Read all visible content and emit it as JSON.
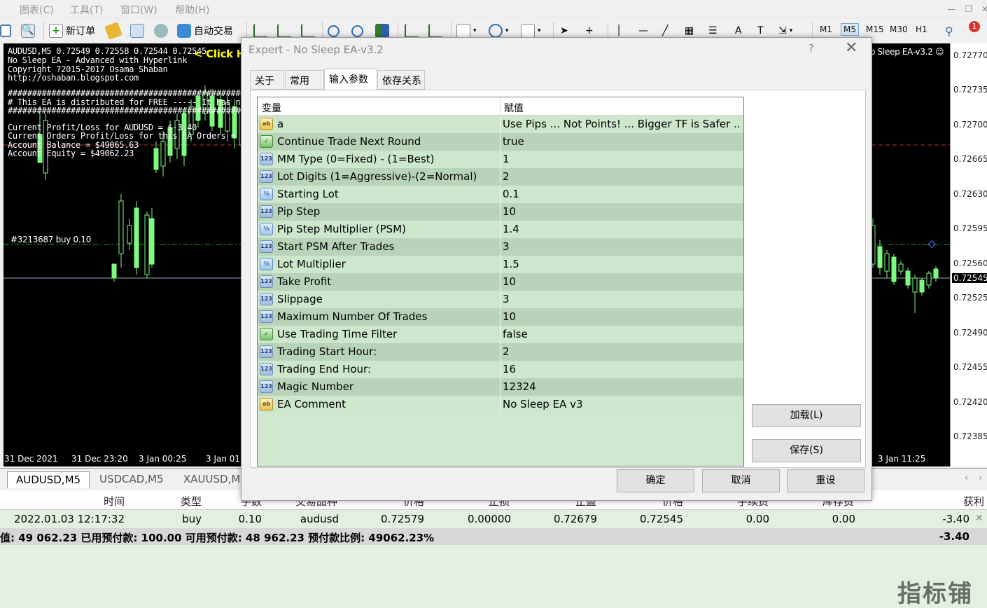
{
  "menubar": {
    "items": [
      "图表(C)",
      "工具(T)",
      "窗口(W)",
      "帮助(H)"
    ]
  },
  "toolbar": {
    "new_order": "新订单",
    "auto_trade": "自动交易",
    "timeframes": [
      "M1",
      "M5",
      "M15",
      "M30",
      "H1"
    ],
    "selected_timeframe": "M5",
    "notification_count": "1"
  },
  "chart": {
    "header_lines": [
      "AUDUSD,M5  0.72549 0.72558 0.72544 0.72545",
      "No Sleep EA - Advanced with Hyperlink",
      "Copyright ?2015-2017  Osama Shaban",
      "http://oshaban.blogspot.com",
      "##################################################",
      "#     This EA is distributed for FREE  -----  It has no Expiry pe",
      "##################################################",
      "Current Profit/Loss for AUDUSD = $-3.40",
      "Current Orders Profit/Loss for this EA Orders = $-3.40",
      "Account Balance = $49065.63",
      "Account Equity = $49062.23"
    ],
    "click_text": "< Click H",
    "ea_label": "o Sleep EA-v3.2",
    "order_label": "#3213687 buy 0.10",
    "y_labels": [
      "0.72770",
      "0.72735",
      "0.72700",
      "0.72665",
      "0.72630",
      "0.72595",
      "0.72560",
      "0.72545",
      "0.72525",
      "0.72490",
      "0.72455",
      "0.72420",
      "0.72385"
    ],
    "current_price": "0.72545",
    "x_labels": [
      "31 Dec 2021",
      "31 Dec 23:20",
      "3 Jan 00:25",
      "3 Jan 01:",
      "3 Jan 11:25"
    ]
  },
  "symbol_tabs": [
    "AUDUSD,M5",
    "USDCAD,M5",
    "XAUUSD,M"
  ],
  "terminal": {
    "headers": [
      "时间",
      "类型",
      "手数",
      "交易品种",
      "价格",
      "止损",
      "止盈",
      "价格",
      "手续费",
      "库存费",
      "获利"
    ],
    "row": [
      "2022.01.03 12:17:32",
      "buy",
      "0.10",
      "audusd",
      "0.72579",
      "0.00000",
      "0.72679",
      "0.72545",
      "0.00",
      "0.00",
      "-3.40"
    ],
    "summary": "值: 49 062.23  已用预付款: 100.00  可用预付款: 48 962.23  预付款比例: 49062.23%",
    "summary_profit": "-3.40"
  },
  "dialog": {
    "title": "Expert - No Sleep EA-v3.2",
    "help": "?",
    "tabs": [
      "关于",
      "常用",
      "输入参数",
      "依存关系"
    ],
    "active_tab": "输入参数",
    "col_variable": "变量",
    "col_value": "赋值",
    "params": [
      {
        "icon": "ab",
        "name": "a",
        "value": "Use Pips ... Not Points! ... Bigger TF is Safer ..."
      },
      {
        "icon": "bool",
        "name": "Continue Trade Next Round",
        "value": "true"
      },
      {
        "icon": "123",
        "name": "MM Type (0=Fixed) - (1=Best)",
        "value": "1"
      },
      {
        "icon": "123",
        "name": "Lot Digits (1=Aggressive)-(2=Normal)",
        "value": "2"
      },
      {
        "icon": "half",
        "name": "Starting Lot",
        "value": "0.1"
      },
      {
        "icon": "123",
        "name": "Pip Step",
        "value": "10"
      },
      {
        "icon": "half",
        "name": "Pip Step Multiplier (PSM)",
        "value": "1.4"
      },
      {
        "icon": "123",
        "name": "Start PSM After Trades",
        "value": "3"
      },
      {
        "icon": "half",
        "name": "Lot Multiplier",
        "value": "1.5"
      },
      {
        "icon": "123",
        "name": "Take Profit",
        "value": "10"
      },
      {
        "icon": "123",
        "name": "Slippage",
        "value": "3"
      },
      {
        "icon": "123",
        "name": "Maximum Number Of Trades",
        "value": "10"
      },
      {
        "icon": "bool",
        "name": "Use Trading Time Filter",
        "value": "false"
      },
      {
        "icon": "123",
        "name": "Trading Start Hour:",
        "value": "2"
      },
      {
        "icon": "123",
        "name": "Trading End Hour:",
        "value": "16"
      },
      {
        "icon": "123",
        "name": "Magic Number",
        "value": "12324"
      },
      {
        "icon": "ab",
        "name": "EA Comment",
        "value": "No Sleep EA v3"
      }
    ],
    "load_button": "加载(L)",
    "save_button": "保存(S)",
    "ok_button": "确定",
    "cancel_button": "取消",
    "reset_button": "重设"
  },
  "watermark": "指标铺",
  "colors": {
    "chart_bg": "#000000",
    "candle_up": "#7cfc7c",
    "grid_bg": "#cde7cd",
    "grid_alt": "#b9d3b9",
    "terminal_bg": "#e3f0e1",
    "click_text": "#ffff00"
  }
}
